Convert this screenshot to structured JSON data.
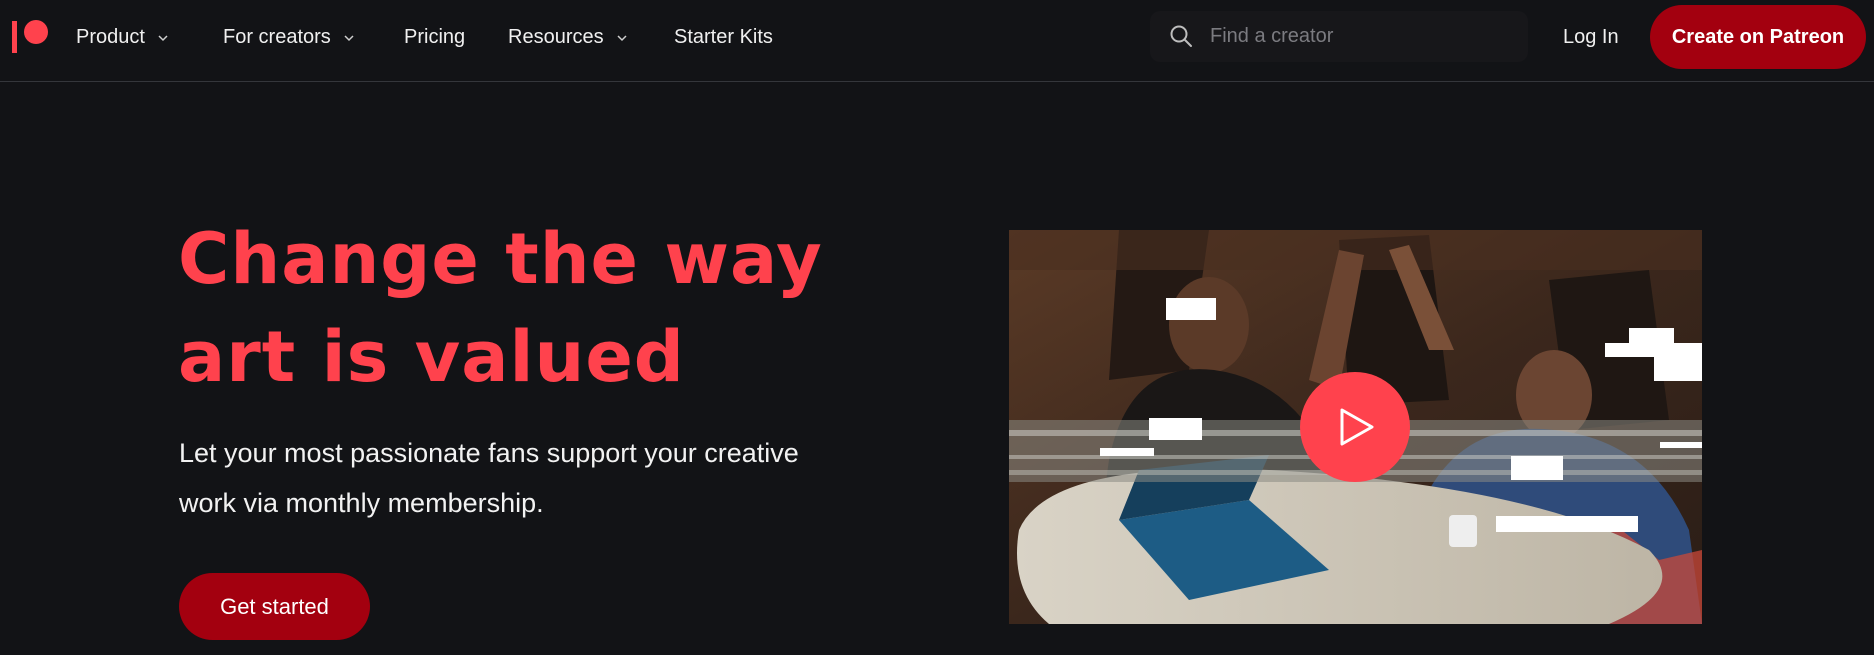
{
  "nav": {
    "logo": "patreon-logo",
    "items": [
      {
        "label": "Product",
        "has_dropdown": true
      },
      {
        "label": "For creators",
        "has_dropdown": true
      },
      {
        "label": "Pricing",
        "has_dropdown": false
      },
      {
        "label": "Resources",
        "has_dropdown": true
      },
      {
        "label": "Starter Kits",
        "has_dropdown": false
      }
    ],
    "search": {
      "placeholder": "Find a creator",
      "value": ""
    },
    "login_label": "Log In",
    "cta_label": "Create on Patreon"
  },
  "hero": {
    "headline_line1": "Change the way",
    "headline_line2": "art is valued",
    "subheading_line1": "Let your most passionate fans support your creative",
    "subheading_line2": "work via monthly membership.",
    "cta_label": "Get started"
  },
  "video": {
    "play_icon": "play-icon"
  },
  "colors": {
    "background": "#121316",
    "brand_coral": "#ff424d",
    "brand_red": "#a3000f",
    "text": "#f0f0f0",
    "muted": "#7b7b80"
  }
}
